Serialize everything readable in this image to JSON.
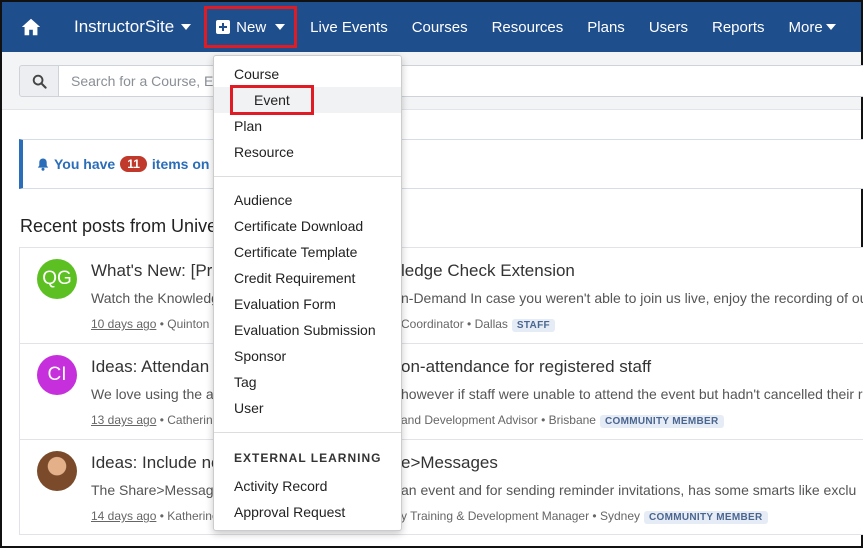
{
  "nav": {
    "brand": "InstructorSite",
    "new_label": "New",
    "items": [
      "Live Events",
      "Courses",
      "Resources",
      "Plans",
      "Users",
      "Reports"
    ],
    "more_label": "More"
  },
  "search": {
    "placeholder": "Search for a Course, Event, Resource..."
  },
  "alert": {
    "prefix": "You have",
    "count": "11",
    "suffix": "items on yo"
  },
  "section_title": "Recent posts from Unive",
  "dropdown": {
    "group1": [
      "Course",
      "Event",
      "Plan",
      "Resource"
    ],
    "group2": [
      "Audience",
      "Certificate Download",
      "Certificate Template",
      "Credit Requirement",
      "Evaluation Form",
      "Evaluation Submission",
      "Sponsor",
      "Tag",
      "User"
    ],
    "header": "EXTERNAL LEARNING",
    "group3": [
      "Activity Record",
      "Approval Request"
    ]
  },
  "posts": [
    {
      "initials": "QG",
      "avatar_color": "#5cc022",
      "title_left": "What's New: [Pro",
      "title_right": "ledge Check Extension",
      "snippet_left": "Watch the Knowledg",
      "snippet_right": "n-Demand In case you weren't able to join us live, enjoy the recording of our",
      "time": "10 days ago",
      "author_left": " • Quinton G",
      "meta_right": "Coordinator • Dallas",
      "badge": "STAFF"
    },
    {
      "initials": "CI",
      "avatar_color": "#c62fdc",
      "title_left": "Ideas: Attendan",
      "title_right": "on-attendance for registered staff",
      "snippet_left": "We love using the at",
      "snippet_right": "however if staff were unable to attend the event but hadn't cancelled their re",
      "time": "13 days ago",
      "author_left": " • Catherine",
      "meta_right": "and Development Advisor • Brisbane",
      "badge": "COMMUNITY MEMBER"
    },
    {
      "initials": "",
      "avatar_color": "#7a4a2a",
      "title_left": "Ideas: Include no",
      "title_right": "e>Messages",
      "snippet_left": "The Share>Message",
      "snippet_right": "an event and for sending reminder invitations, has some smarts like exclu",
      "time": "14 days ago",
      "author_left": " • Katherine",
      "meta_right": "y Training & Development Manager • Sydney",
      "badge": "COMMUNITY MEMBER"
    }
  ]
}
